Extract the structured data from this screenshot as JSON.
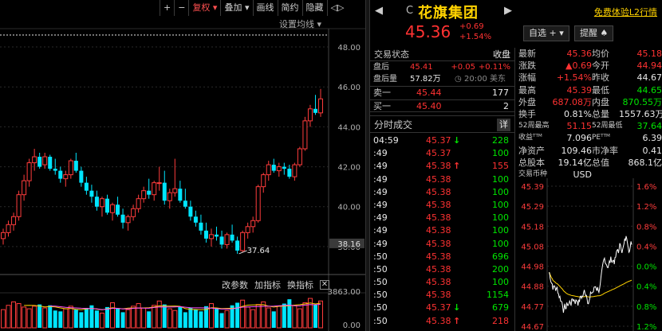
{
  "toolbar": {
    "items": [
      "+",
      "−",
      "复权 ▾",
      "叠加 ▾",
      "画线",
      "简约",
      "隐藏",
      "◁▷"
    ]
  },
  "kchart": {
    "setting_label": "设置均线 ▾",
    "price_ticks": [
      "48.00",
      "46.00",
      "44.00",
      "42.00",
      "40.00",
      "38.00"
    ],
    "price_marker": "38.16",
    "low_label": "37.64",
    "vol_tick_top": "3863.00",
    "vol_tick_bottom": "0.00",
    "buttons": [
      "改参数",
      "加指标",
      "换指标"
    ],
    "close_icon": "✕",
    "ylim": [
      37.0,
      48.6
    ],
    "candles": [
      [
        38.4,
        38.9,
        38.1,
        38.7
      ],
      [
        38.7,
        39.3,
        38.5,
        39.1
      ],
      [
        39.1,
        39.7,
        38.8,
        39.5
      ],
      [
        39.5,
        40.8,
        39.3,
        40.6
      ],
      [
        40.6,
        41.6,
        40.3,
        41.3
      ],
      [
        41.3,
        42.4,
        41.0,
        42.2
      ],
      [
        42.2,
        42.9,
        41.8,
        42.5
      ],
      [
        42.5,
        42.7,
        41.9,
        42.0
      ],
      [
        42.1,
        42.7,
        41.9,
        42.5
      ],
      [
        42.5,
        42.6,
        41.8,
        41.9
      ],
      [
        41.9,
        42.4,
        41.6,
        41.8
      ],
      [
        41.8,
        42.0,
        41.2,
        41.4
      ],
      [
        41.4,
        41.8,
        41.0,
        41.6
      ],
      [
        41.6,
        42.4,
        41.4,
        42.3
      ],
      [
        42.3,
        42.7,
        41.7,
        41.8
      ],
      [
        41.8,
        42.0,
        41.0,
        41.2
      ],
      [
        41.2,
        41.5,
        40.6,
        40.8
      ],
      [
        40.8,
        41.1,
        40.2,
        40.5
      ],
      [
        40.5,
        40.8,
        39.8,
        40.0
      ],
      [
        40.0,
        40.5,
        39.5,
        40.4
      ],
      [
        40.4,
        40.6,
        39.6,
        39.7
      ],
      [
        39.7,
        40.2,
        39.3,
        40.1
      ],
      [
        40.1,
        40.5,
        39.5,
        39.6
      ],
      [
        39.6,
        39.9,
        38.9,
        39.2
      ],
      [
        39.2,
        39.6,
        38.8,
        39.5
      ],
      [
        39.5,
        40.1,
        39.3,
        39.9
      ],
      [
        39.9,
        40.6,
        39.7,
        40.4
      ],
      [
        40.4,
        41.0,
        40.2,
        40.8
      ],
      [
        40.8,
        41.4,
        40.4,
        40.6
      ],
      [
        40.6,
        41.3,
        40.3,
        41.2
      ],
      [
        41.2,
        42.0,
        40.8,
        41.2
      ],
      [
        41.2,
        41.8,
        40.1,
        40.3
      ],
      [
        40.3,
        40.9,
        39.9,
        40.7
      ],
      [
        40.7,
        42.4,
        40.5,
        40.9
      ],
      [
        40.9,
        41.3,
        40.2,
        40.3
      ],
      [
        40.3,
        40.9,
        39.9,
        40.0
      ],
      [
        40.0,
        40.3,
        39.3,
        39.5
      ],
      [
        39.5,
        39.8,
        39.0,
        39.2
      ],
      [
        39.2,
        39.6,
        38.6,
        38.8
      ],
      [
        38.8,
        39.2,
        38.2,
        38.4
      ],
      [
        38.4,
        38.9,
        38.0,
        38.6
      ],
      [
        38.6,
        39.0,
        38.3,
        38.5
      ],
      [
        38.5,
        38.8,
        37.9,
        38.1
      ],
      [
        38.1,
        38.7,
        37.9,
        38.6
      ],
      [
        38.6,
        39.1,
        38.2,
        38.3
      ],
      [
        38.3,
        38.5,
        37.64,
        37.8
      ],
      [
        37.8,
        38.8,
        37.7,
        38.7
      ],
      [
        38.7,
        39.2,
        38.4,
        39.0
      ],
      [
        39.0,
        39.5,
        38.7,
        39.3
      ],
      [
        39.3,
        41.1,
        39.2,
        41.0
      ],
      [
        41.0,
        41.7,
        40.7,
        41.6
      ],
      [
        41.6,
        42.3,
        41.3,
        42.1
      ],
      [
        42.1,
        42.4,
        41.7,
        41.8
      ],
      [
        41.8,
        42.2,
        41.5,
        42.0
      ],
      [
        42.0,
        42.2,
        41.6,
        41.9
      ],
      [
        41.9,
        42.1,
        41.4,
        41.5
      ],
      [
        41.5,
        42.2,
        41.3,
        42.1
      ],
      [
        42.1,
        43.0,
        42.0,
        42.9
      ],
      [
        42.9,
        44.5,
        42.8,
        44.3
      ],
      [
        44.3,
        45.1,
        44.0,
        44.9
      ],
      [
        44.9,
        45.6,
        44.6,
        44.7
      ],
      [
        44.7,
        45.9,
        44.5,
        45.4
      ]
    ],
    "volumes": [
      2100,
      2600,
      3000,
      2800,
      2400,
      2200,
      2500,
      2700,
      2300,
      2600,
      2000,
      1900,
      2200,
      2500,
      2100,
      1800,
      2300,
      2600,
      2000,
      1700,
      2400,
      2900,
      2200,
      1800,
      2100,
      2500,
      2800,
      2300,
      1900,
      2600,
      3100,
      2700,
      2200,
      2000,
      2400,
      1800,
      2300,
      2100,
      1900,
      2500,
      2800,
      2200,
      1700,
      2000,
      2600,
      2900,
      3200,
      2400,
      2100,
      2700,
      3000,
      2300,
      1900,
      2500,
      2800,
      3300,
      2600,
      2200,
      2900,
      3400,
      2700,
      3100
    ],
    "vol_max": 3863
  },
  "stock": {
    "nav_left": "◀",
    "nav_right": "▶",
    "code": "C",
    "name": "花旗集团",
    "free_link": "免费体验L2行情",
    "price": "45.36",
    "change": "+0.69",
    "change_pct": "+1.54%",
    "btn_watch": "自选 + ▾",
    "btn_alert": "提醒 ♠"
  },
  "trade_status": {
    "title": "交易状态",
    "status": "收盘",
    "rows": [
      {
        "label": "盘后",
        "price": "45.41",
        "chg": "+0.05",
        "pct": "+0.11%"
      },
      {
        "label": "盘后量",
        "vol": "57.82万",
        "time": "20:00 美东"
      }
    ],
    "sell1": {
      "label": "卖一",
      "price": "45.44",
      "qty": "177"
    },
    "buy1": {
      "label": "买一",
      "price": "45.40",
      "qty": "2"
    }
  },
  "ticks": {
    "title": "分时成交",
    "detail_btn": "详",
    "rows": [
      {
        "time": "04:59",
        "price": "45.37",
        "arrow": "↓",
        "vol": "228",
        "up": false
      },
      {
        "time": ":49",
        "price": "45.37",
        "arrow": "",
        "vol": "100",
        "up": false
      },
      {
        "time": ":49",
        "price": "45.38",
        "arrow": "↑",
        "vol": "155",
        "up": true
      },
      {
        "time": ":49",
        "price": "45.38",
        "arrow": "",
        "vol": "100",
        "up": false
      },
      {
        "time": ":49",
        "price": "45.38",
        "arrow": "",
        "vol": "100",
        "up": false
      },
      {
        "time": ":49",
        "price": "45.38",
        "arrow": "",
        "vol": "100",
        "up": false
      },
      {
        "time": ":49",
        "price": "45.38",
        "arrow": "",
        "vol": "100",
        "up": false
      },
      {
        "time": ":49",
        "price": "45.38",
        "arrow": "",
        "vol": "100",
        "up": false
      },
      {
        "time": ":49",
        "price": "45.38",
        "arrow": "",
        "vol": "100",
        "up": false
      },
      {
        "time": ":50",
        "price": "45.38",
        "arrow": "",
        "vol": "696",
        "up": false
      },
      {
        "time": ":50",
        "price": "45.38",
        "arrow": "",
        "vol": "200",
        "up": false
      },
      {
        "time": ":50",
        "price": "45.38",
        "arrow": "",
        "vol": "100",
        "up": false
      },
      {
        "time": ":50",
        "price": "45.38",
        "arrow": "",
        "vol": "1154",
        "up": false
      },
      {
        "time": ":50",
        "price": "45.37",
        "arrow": "↓",
        "vol": "679",
        "up": false
      },
      {
        "time": ":50",
        "price": "45.38",
        "arrow": "↑",
        "vol": "218",
        "up": true
      }
    ]
  },
  "quote": {
    "rows": [
      [
        {
          "k": "最新",
          "v": "45.36",
          "c": "red"
        },
        {
          "k": "均价",
          "v": "45.18",
          "c": "red"
        }
      ],
      [
        {
          "k": "涨跌",
          "v": "▲0.69",
          "c": "red"
        },
        {
          "k": "今开",
          "v": "44.94",
          "c": "red"
        }
      ],
      [
        {
          "k": "涨幅",
          "v": "+1.54%",
          "c": "red"
        },
        {
          "k": "昨收",
          "v": "44.67",
          "c": "wht"
        }
      ],
      [
        {
          "k": "最高",
          "v": "45.39",
          "c": "red"
        },
        {
          "k": "最低",
          "v": "44.65",
          "c": "grn"
        }
      ],
      [
        {
          "k": "外盘",
          "v": "687.08万",
          "c": "red"
        },
        {
          "k": "内盘",
          "v": "870.55万",
          "c": "grn"
        }
      ],
      [
        {
          "k": "换手",
          "v": "0.81%",
          "c": "wht"
        },
        {
          "k": "总量",
          "v": "1557.63万",
          "c": "wht"
        }
      ],
      [
        {
          "k": "52周最高",
          "v": "51.15",
          "c": "red"
        },
        {
          "k": "52周最低",
          "v": "37.64",
          "c": "grn"
        }
      ],
      [
        {
          "k": "收益ᵀᵀᴹ",
          "v": "7.096",
          "c": "wht"
        },
        {
          "k": "PEᵀᵀᴹ",
          "v": "6.39",
          "c": "wht"
        }
      ],
      [
        {
          "k": "净资产",
          "v": "109.46",
          "c": "wht"
        },
        {
          "k": "市净率",
          "v": "0.41",
          "c": "wht"
        }
      ],
      [
        {
          "k": "总股本",
          "v": "19.14亿",
          "c": "wht"
        },
        {
          "k": "总值",
          "v": "868.1亿",
          "c": "wht"
        }
      ],
      [
        {
          "k": "交易币种",
          "v": "USD",
          "c": "wht"
        },
        {
          "k": "",
          "v": "",
          "c": "wht"
        }
      ]
    ]
  },
  "mini_chart": {
    "price_ticks": [
      "45.39",
      "45.29",
      "45.18",
      "45.08",
      "44.98",
      "44.88",
      "44.77",
      "44.67"
    ],
    "pct_ticks": [
      "1.6%",
      "1.2%",
      "0.8%",
      "0.4%",
      "0.0%",
      "0.4%",
      "0.8%",
      "1.2%"
    ],
    "prev_close": 44.67,
    "ylim": [
      44.67,
      45.39
    ]
  }
}
